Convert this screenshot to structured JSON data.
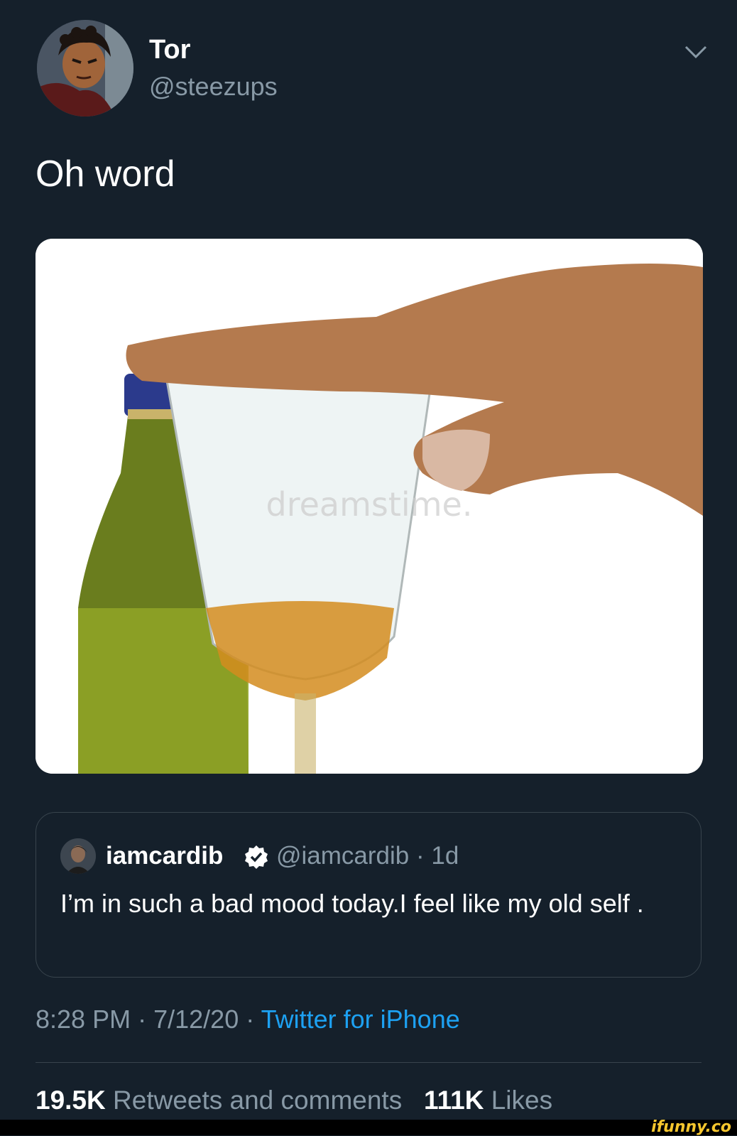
{
  "tweet": {
    "author": {
      "name": "Tor",
      "handle": "@steezups",
      "avatar_icon": "cartoon-avatar"
    },
    "text": "Oh word",
    "media": {
      "kind": "photo",
      "watermark_text": "dreamstime."
    },
    "more_icon": "chevron-down-icon"
  },
  "quoted_tweet": {
    "name": "iamcardib",
    "verified": true,
    "handle": "@iamcardib",
    "separator": "·",
    "age": "1d",
    "text": "I’m in such a bad mood today.I feel like my old self ."
  },
  "meta": {
    "time": "8:28 PM",
    "separator": "·",
    "date": "7/12/20",
    "source": "Twitter for iPhone"
  },
  "stats": {
    "retweets_count": "19.5K",
    "retweets_label": "Retweets and comments",
    "likes_count": "111K",
    "likes_label": "Likes"
  },
  "watermark": "ifunny.co",
  "colors": {
    "background": "#15202b",
    "secondary_text": "#8899a6",
    "link": "#1da1f2",
    "border": "#38444d",
    "watermark": "#f7c72e"
  }
}
